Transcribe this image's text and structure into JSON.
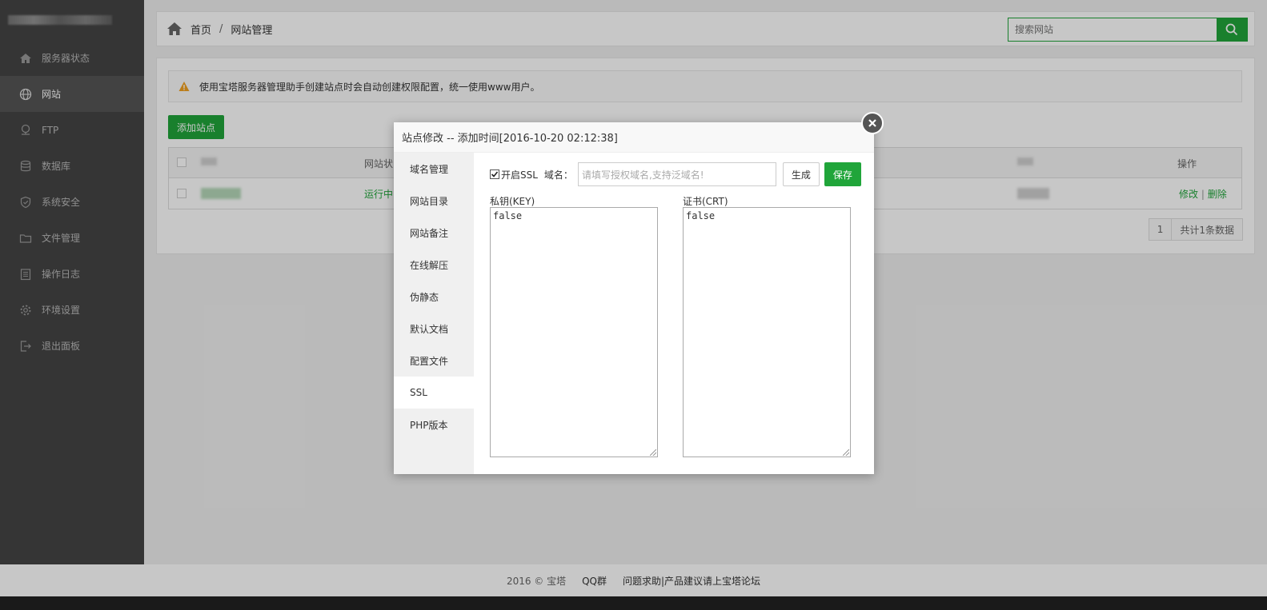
{
  "sidebar": {
    "items": [
      {
        "label": "服务器状态",
        "icon": "home-icon"
      },
      {
        "label": "网站",
        "icon": "globe-icon"
      },
      {
        "label": "FTP",
        "icon": "ftp-icon"
      },
      {
        "label": "数据库",
        "icon": "database-icon"
      },
      {
        "label": "系统安全",
        "icon": "shield-icon"
      },
      {
        "label": "文件管理",
        "icon": "folder-icon"
      },
      {
        "label": "操作日志",
        "icon": "log-icon"
      },
      {
        "label": "环境设置",
        "icon": "gear-icon"
      },
      {
        "label": "退出面板",
        "icon": "logout-icon"
      }
    ],
    "active_index": 1
  },
  "header": {
    "breadcrumb_home": "首页",
    "breadcrumb_sep": "/",
    "breadcrumb_current": "网站管理",
    "search_placeholder": "搜索网站"
  },
  "notice": "使用宝塔服务器管理助手创建站点时会自动创建权限配置，统一使用www用户。",
  "add_site_label": "添加站点",
  "table": {
    "headers": [
      "网站状",
      "操作"
    ],
    "rows": [
      {
        "status": "运行中",
        "edit": "修改",
        "sep": "|",
        "delete": "删除"
      }
    ]
  },
  "pagination": {
    "page": "1",
    "total": "共计1条数据"
  },
  "modal": {
    "title": "站点修改 -- 添加时间[2016-10-20 02:12:38]",
    "tabs": [
      "域名管理",
      "网站目录",
      "网站备注",
      "在线解压",
      "伪静态",
      "默认文档",
      "配置文件",
      "SSL",
      "PHP版本"
    ],
    "active_tab": "SSL",
    "ssl": {
      "enable_label": "开启SSL",
      "enabled": true,
      "domain_label": "域名：",
      "domain_placeholder": "请填写授权域名,支持泛域名!",
      "generate_label": "生成",
      "save_label": "保存",
      "key_label": "私钥(KEY)",
      "key_value": "false",
      "crt_label": "证书(CRT)",
      "crt_value": "false"
    }
  },
  "footer": {
    "copyright": "2016 © 宝塔",
    "qq": "QQ群",
    "forum": "问题求助|产品建议请上宝塔论坛"
  },
  "colors": {
    "accent": "#20a53a",
    "sidebar": "#444444",
    "warning": "#f0a020"
  }
}
